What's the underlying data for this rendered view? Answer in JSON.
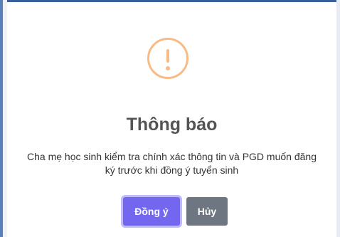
{
  "dialog": {
    "icon": "exclamation-warning-icon",
    "title": "Thông báo",
    "message": "Cha mẹ học sinh kiểm tra chính xác thông tin và PGD muốn đăng ký trước khi đồng ý tuyển sinh",
    "confirm_label": "Đồng ý",
    "cancel_label": "Hủy"
  },
  "colors": {
    "warning": "#f8bb86",
    "confirm": "#7367f0",
    "cancel": "#6e7781",
    "title": "#545454"
  }
}
